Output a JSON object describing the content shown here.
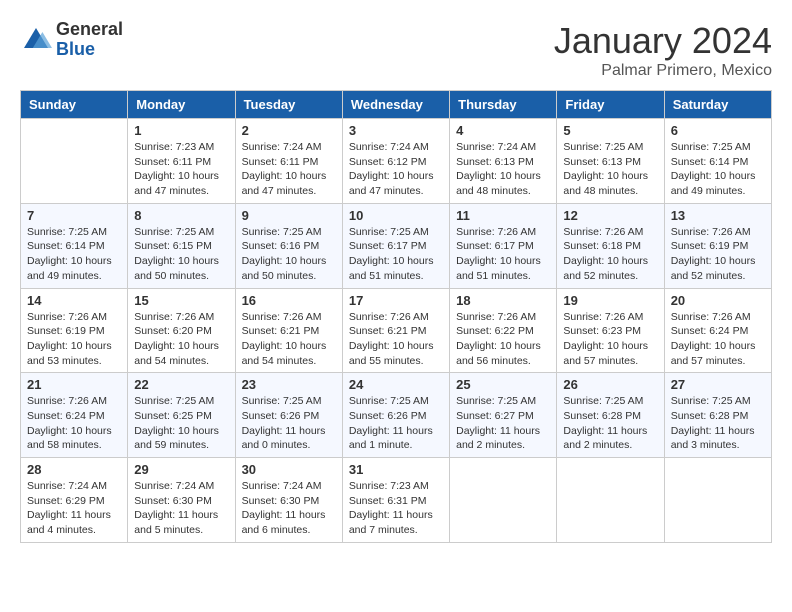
{
  "header": {
    "logo_general": "General",
    "logo_blue": "Blue",
    "month_title": "January 2024",
    "location": "Palmar Primero, Mexico"
  },
  "days_of_week": [
    "Sunday",
    "Monday",
    "Tuesday",
    "Wednesday",
    "Thursday",
    "Friday",
    "Saturday"
  ],
  "weeks": [
    [
      {
        "day": "",
        "info": ""
      },
      {
        "day": "1",
        "info": "Sunrise: 7:23 AM\nSunset: 6:11 PM\nDaylight: 10 hours\nand 47 minutes."
      },
      {
        "day": "2",
        "info": "Sunrise: 7:24 AM\nSunset: 6:11 PM\nDaylight: 10 hours\nand 47 minutes."
      },
      {
        "day": "3",
        "info": "Sunrise: 7:24 AM\nSunset: 6:12 PM\nDaylight: 10 hours\nand 47 minutes."
      },
      {
        "day": "4",
        "info": "Sunrise: 7:24 AM\nSunset: 6:13 PM\nDaylight: 10 hours\nand 48 minutes."
      },
      {
        "day": "5",
        "info": "Sunrise: 7:25 AM\nSunset: 6:13 PM\nDaylight: 10 hours\nand 48 minutes."
      },
      {
        "day": "6",
        "info": "Sunrise: 7:25 AM\nSunset: 6:14 PM\nDaylight: 10 hours\nand 49 minutes."
      }
    ],
    [
      {
        "day": "7",
        "info": "Sunrise: 7:25 AM\nSunset: 6:14 PM\nDaylight: 10 hours\nand 49 minutes."
      },
      {
        "day": "8",
        "info": "Sunrise: 7:25 AM\nSunset: 6:15 PM\nDaylight: 10 hours\nand 50 minutes."
      },
      {
        "day": "9",
        "info": "Sunrise: 7:25 AM\nSunset: 6:16 PM\nDaylight: 10 hours\nand 50 minutes."
      },
      {
        "day": "10",
        "info": "Sunrise: 7:25 AM\nSunset: 6:17 PM\nDaylight: 10 hours\nand 51 minutes."
      },
      {
        "day": "11",
        "info": "Sunrise: 7:26 AM\nSunset: 6:17 PM\nDaylight: 10 hours\nand 51 minutes."
      },
      {
        "day": "12",
        "info": "Sunrise: 7:26 AM\nSunset: 6:18 PM\nDaylight: 10 hours\nand 52 minutes."
      },
      {
        "day": "13",
        "info": "Sunrise: 7:26 AM\nSunset: 6:19 PM\nDaylight: 10 hours\nand 52 minutes."
      }
    ],
    [
      {
        "day": "14",
        "info": "Sunrise: 7:26 AM\nSunset: 6:19 PM\nDaylight: 10 hours\nand 53 minutes."
      },
      {
        "day": "15",
        "info": "Sunrise: 7:26 AM\nSunset: 6:20 PM\nDaylight: 10 hours\nand 54 minutes."
      },
      {
        "day": "16",
        "info": "Sunrise: 7:26 AM\nSunset: 6:21 PM\nDaylight: 10 hours\nand 54 minutes."
      },
      {
        "day": "17",
        "info": "Sunrise: 7:26 AM\nSunset: 6:21 PM\nDaylight: 10 hours\nand 55 minutes."
      },
      {
        "day": "18",
        "info": "Sunrise: 7:26 AM\nSunset: 6:22 PM\nDaylight: 10 hours\nand 56 minutes."
      },
      {
        "day": "19",
        "info": "Sunrise: 7:26 AM\nSunset: 6:23 PM\nDaylight: 10 hours\nand 57 minutes."
      },
      {
        "day": "20",
        "info": "Sunrise: 7:26 AM\nSunset: 6:24 PM\nDaylight: 10 hours\nand 57 minutes."
      }
    ],
    [
      {
        "day": "21",
        "info": "Sunrise: 7:26 AM\nSunset: 6:24 PM\nDaylight: 10 hours\nand 58 minutes."
      },
      {
        "day": "22",
        "info": "Sunrise: 7:25 AM\nSunset: 6:25 PM\nDaylight: 10 hours\nand 59 minutes."
      },
      {
        "day": "23",
        "info": "Sunrise: 7:25 AM\nSunset: 6:26 PM\nDaylight: 11 hours\nand 0 minutes."
      },
      {
        "day": "24",
        "info": "Sunrise: 7:25 AM\nSunset: 6:26 PM\nDaylight: 11 hours\nand 1 minute."
      },
      {
        "day": "25",
        "info": "Sunrise: 7:25 AM\nSunset: 6:27 PM\nDaylight: 11 hours\nand 2 minutes."
      },
      {
        "day": "26",
        "info": "Sunrise: 7:25 AM\nSunset: 6:28 PM\nDaylight: 11 hours\nand 2 minutes."
      },
      {
        "day": "27",
        "info": "Sunrise: 7:25 AM\nSunset: 6:28 PM\nDaylight: 11 hours\nand 3 minutes."
      }
    ],
    [
      {
        "day": "28",
        "info": "Sunrise: 7:24 AM\nSunset: 6:29 PM\nDaylight: 11 hours\nand 4 minutes."
      },
      {
        "day": "29",
        "info": "Sunrise: 7:24 AM\nSunset: 6:30 PM\nDaylight: 11 hours\nand 5 minutes."
      },
      {
        "day": "30",
        "info": "Sunrise: 7:24 AM\nSunset: 6:30 PM\nDaylight: 11 hours\nand 6 minutes."
      },
      {
        "day": "31",
        "info": "Sunrise: 7:23 AM\nSunset: 6:31 PM\nDaylight: 11 hours\nand 7 minutes."
      },
      {
        "day": "",
        "info": ""
      },
      {
        "day": "",
        "info": ""
      },
      {
        "day": "",
        "info": ""
      }
    ]
  ]
}
